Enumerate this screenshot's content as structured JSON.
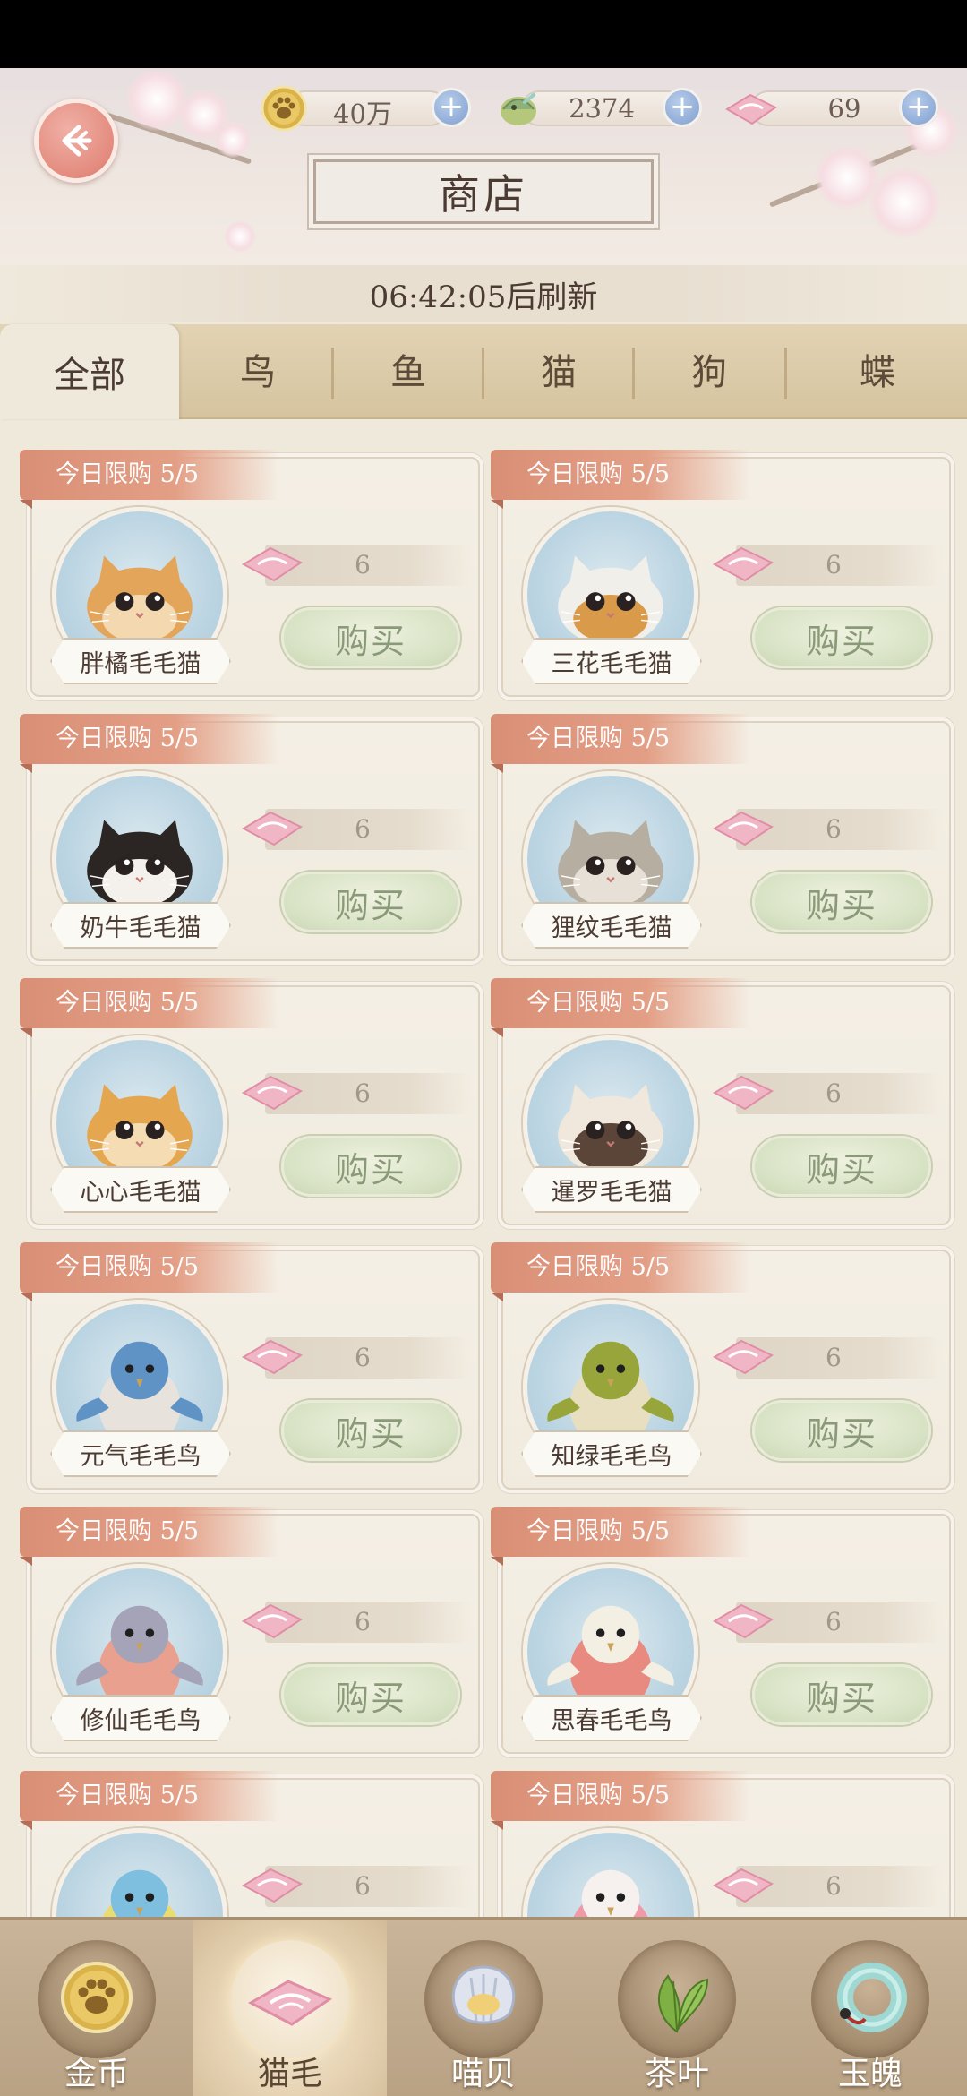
{
  "header": {
    "title": "商店",
    "back_icon": "back-arrow-icon",
    "currencies": [
      {
        "icon": "paw-coin-icon",
        "value": "40万"
      },
      {
        "icon": "shell-icon",
        "value": "2374"
      },
      {
        "icon": "cat-fur-icon",
        "value": "69"
      }
    ],
    "refresh_text": "06:42:05后刷新"
  },
  "tabs": [
    "全部",
    "鸟",
    "鱼",
    "猫",
    "狗",
    "蝶"
  ],
  "active_tab": "全部",
  "items": [
    {
      "name": "胖橘毛毛猫",
      "limit": "今日限购 5/5",
      "price": "6",
      "buy": "购买",
      "kind": "cat",
      "colors": [
        "#e3a55a",
        "#f3d8b0"
      ]
    },
    {
      "name": "三花毛毛猫",
      "limit": "今日限购 5/5",
      "price": "6",
      "buy": "购买",
      "kind": "cat",
      "colors": [
        "#f1efea",
        "#d99a4a"
      ]
    },
    {
      "name": "奶牛毛毛猫",
      "limit": "今日限购 5/5",
      "price": "6",
      "buy": "购买",
      "kind": "cat",
      "colors": [
        "#2b2624",
        "#f4f1ec"
      ]
    },
    {
      "name": "狸纹毛毛猫",
      "limit": "今日限购 5/5",
      "price": "6",
      "buy": "购买",
      "kind": "cat",
      "colors": [
        "#b7aea2",
        "#e6e0d6"
      ]
    },
    {
      "name": "心心毛毛猫",
      "limit": "今日限购 5/5",
      "price": "6",
      "buy": "购买",
      "kind": "cat",
      "colors": [
        "#e5a650",
        "#f5dcb3"
      ]
    },
    {
      "name": "暹罗毛毛猫",
      "limit": "今日限购 5/5",
      "price": "6",
      "buy": "购买",
      "kind": "cat",
      "colors": [
        "#f0e8dc",
        "#5b4438"
      ]
    },
    {
      "name": "元气毛毛鸟",
      "limit": "今日限购 5/5",
      "price": "6",
      "buy": "购买",
      "kind": "bird",
      "colors": [
        "#5f93c6",
        "#e7e3dc"
      ]
    },
    {
      "name": "知绿毛毛鸟",
      "limit": "今日限购 5/5",
      "price": "6",
      "buy": "购买",
      "kind": "bird",
      "colors": [
        "#97a53a",
        "#e7dfc0"
      ]
    },
    {
      "name": "修仙毛毛鸟",
      "limit": "今日限购 5/5",
      "price": "6",
      "buy": "购买",
      "kind": "bird",
      "colors": [
        "#a4a3b8",
        "#e9a08e"
      ]
    },
    {
      "name": "思春毛毛鸟",
      "limit": "今日限购 5/5",
      "price": "6",
      "buy": "购买",
      "kind": "bird",
      "colors": [
        "#f4efe3",
        "#e88a7f"
      ]
    },
    {
      "name": "",
      "limit": "今日限购 5/5",
      "price": "6",
      "buy": "",
      "kind": "bird",
      "colors": [
        "#7ebfdf",
        "#e9dc73"
      ]
    },
    {
      "name": "",
      "limit": "今日限购 5/5",
      "price": "6",
      "buy": "",
      "kind": "bird",
      "colors": [
        "#f6f0ee",
        "#ef9aa6"
      ]
    }
  ],
  "bottom_tabs": [
    {
      "label": "金币",
      "icon": "paw-coin-icon"
    },
    {
      "label": "猫毛",
      "icon": "cat-fur-icon"
    },
    {
      "label": "喵贝",
      "icon": "shell-icon"
    },
    {
      "label": "茶叶",
      "icon": "tea-leaf-icon"
    },
    {
      "label": "玉魄",
      "icon": "jade-ring-icon"
    }
  ],
  "active_bottom_tab": "猫毛"
}
